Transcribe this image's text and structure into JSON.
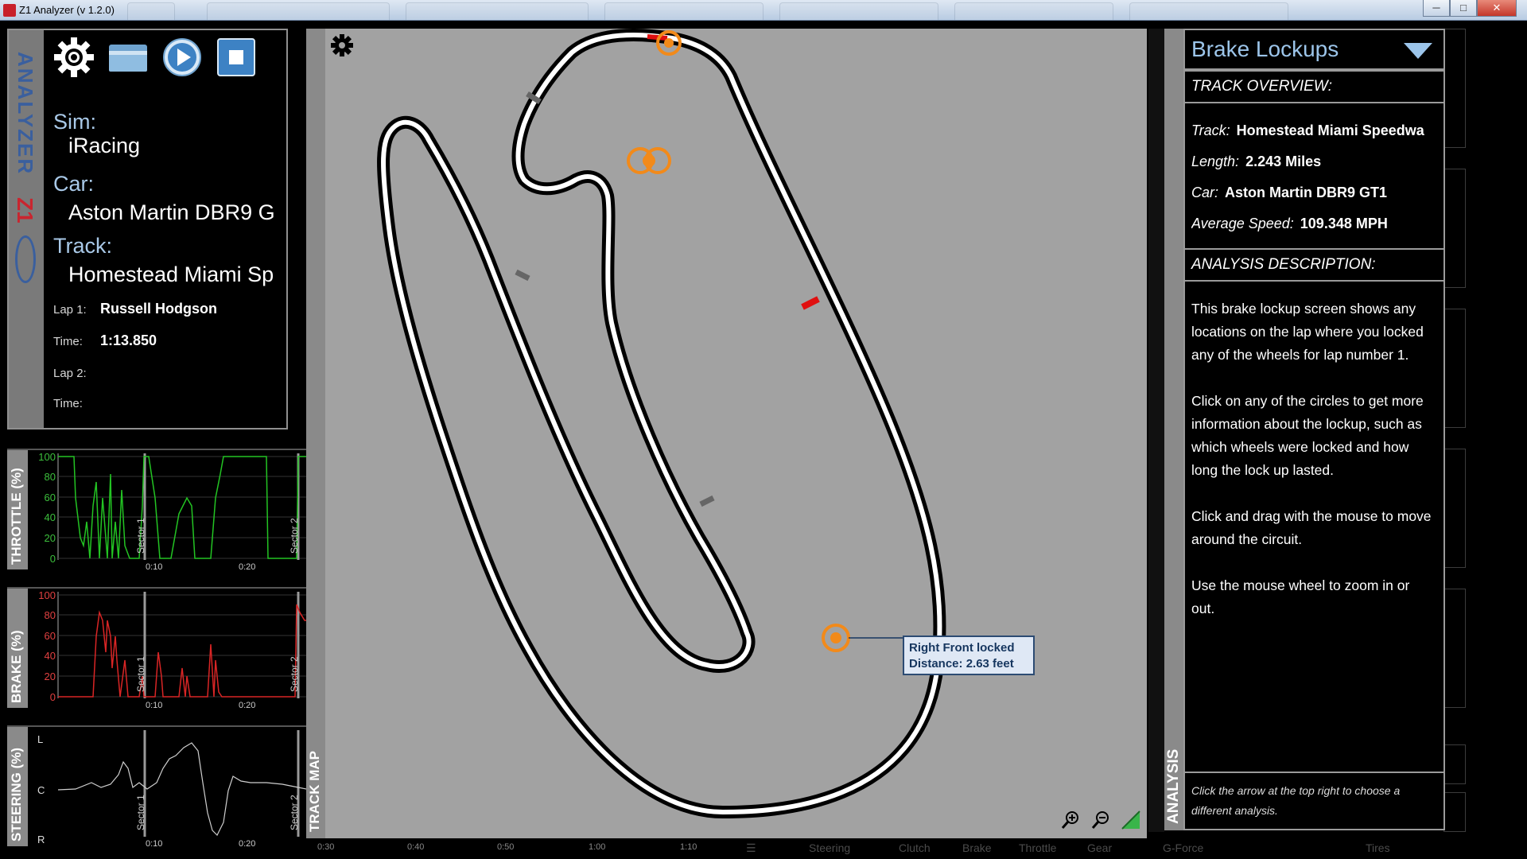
{
  "window": {
    "title": "Z1 Analyzer (v 1.2.0)",
    "buttons": {
      "minimize": "─",
      "maximize": "□",
      "close": "✕"
    }
  },
  "info": {
    "brand_text": "ANALYZER",
    "brand_logo": "Z1",
    "sim_label": "Sim:",
    "sim": "iRacing",
    "car_label": "Car:",
    "car": "Aston Martin DBR9 G",
    "track_label": "Track:",
    "track": "Homestead Miami Sp",
    "lap1_label": "Lap 1:",
    "lap1_driver": "Russell Hodgson",
    "time1_label": "Time:",
    "time1": "1:13.850",
    "lap2_label": "Lap 2:",
    "time2_label": "Time:",
    "icons": [
      "gear-icon",
      "folder-icon",
      "play-icon",
      "stop-icon"
    ]
  },
  "charts": {
    "throttle": {
      "label": "THROTTLE (%)",
      "yticks": [
        "100",
        "80",
        "60",
        "40",
        "20",
        "0"
      ],
      "color": "#23c423"
    },
    "brake": {
      "label": "BRAKE (%)",
      "yticks": [
        "100",
        "80",
        "60",
        "40",
        "20",
        "0"
      ],
      "color": "#d92525"
    },
    "steering": {
      "label": "STEERING (%)",
      "yticks": [
        "L",
        "C",
        "R"
      ],
      "color": "#cfcfcf"
    },
    "sector1": "Sector 1",
    "sector2": "Sector 2",
    "xticks": [
      "0:10",
      "0:20"
    ]
  },
  "map": {
    "side_label": "TRACK MAP",
    "tooltip_line1": "Right Front locked",
    "tooltip_line2": "Distance: 2.63 feet",
    "lockup_color": "#f28a1a",
    "icons": [
      "gear-icon",
      "zoom-in-icon",
      "zoom-out-icon",
      "flag-icon"
    ]
  },
  "time_axis": {
    "ticks": [
      "0:30",
      "0:40",
      "0:50",
      "1:00",
      "1:10"
    ],
    "tabs": [
      "Steering",
      "Clutch",
      "Brake",
      "Throttle",
      "Gear",
      "G-Force",
      "Tires"
    ]
  },
  "analysis": {
    "side_label": "ANALYSIS",
    "title": "Brake Lockups",
    "overview_header": "TRACK OVERVIEW:",
    "track_k": "Track:",
    "track_v": "Homestead Miami Speedwa",
    "length_k": "Length:",
    "length_v": "2.243 Miles",
    "car_k": "Car:",
    "car_v": "Aston Martin DBR9 GT1",
    "speed_k": "Average Speed:",
    "speed_v": "109.348 MPH",
    "desc_header": "ANALYSIS DESCRIPTION:",
    "description": "This brake lockup screen shows any locations on the lap where you locked any of the wheels for lap number 1.\n\nClick on any of the circles to get more information about the lockup, such as which wheels were locked and how long the lock up lasted.\n\nClick and drag with the mouse to move around the circuit.\n\nUse the mouse wheel to zoom in or out.",
    "footer": "Click the arrow at the top right to choose a different analysis."
  }
}
